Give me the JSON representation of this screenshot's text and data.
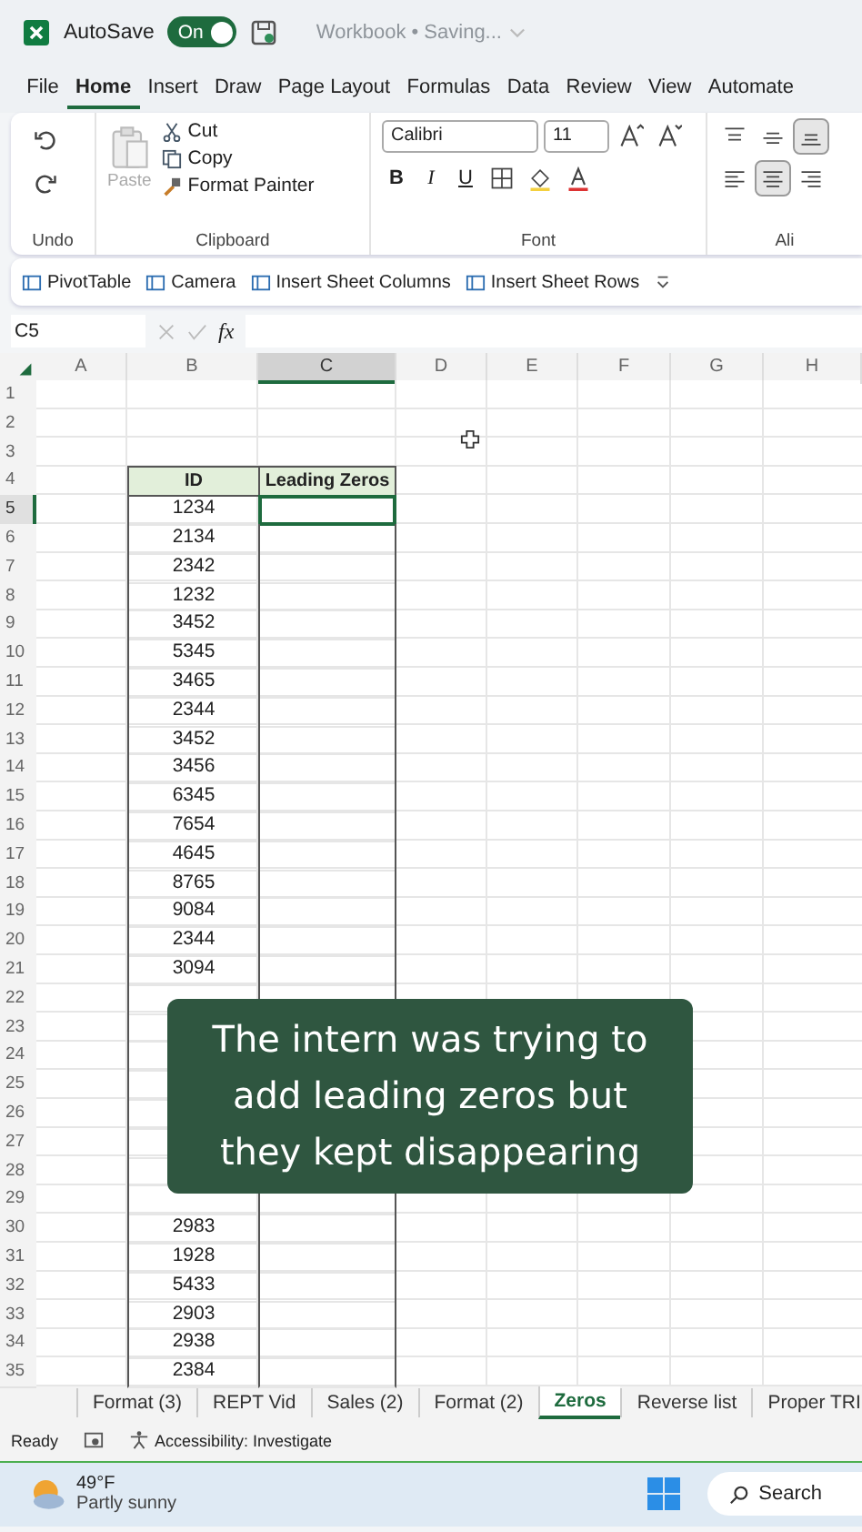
{
  "title_bar": {
    "autosave_label": "AutoSave",
    "autosave_on": true,
    "toggle_text": "On",
    "doc_title": "Workbook • Saving..."
  },
  "menu_tabs": [
    {
      "label": "File",
      "selected": false
    },
    {
      "label": "Home",
      "selected": true
    },
    {
      "label": "Insert",
      "selected": false
    },
    {
      "label": "Draw",
      "selected": false
    },
    {
      "label": "Page Layout",
      "selected": false
    },
    {
      "label": "Formulas",
      "selected": false
    },
    {
      "label": "Data",
      "selected": false
    },
    {
      "label": "Review",
      "selected": false
    },
    {
      "label": "View",
      "selected": false
    },
    {
      "label": "Automate",
      "selected": false
    }
  ],
  "ribbon": {
    "undo_label": "Undo",
    "paste": "Paste",
    "cut": "Cut",
    "copy": "Copy",
    "format_painter": "Format Painter",
    "clipboard_label": "Clipboard",
    "font_name": "Calibri",
    "font_size": "11",
    "bold": "B",
    "italic": "I",
    "underline": "U",
    "font_label": "Font",
    "alignment_label": "Ali"
  },
  "quick_bar": [
    "PivotTable",
    "Camera",
    "Insert Sheet Columns",
    "Insert Sheet Rows"
  ],
  "formula_bar": {
    "name_box": "C5",
    "fx": "fx"
  },
  "columns": [
    {
      "label": "A",
      "selected": false
    },
    {
      "label": "B",
      "selected": false
    },
    {
      "label": "C",
      "selected": true
    },
    {
      "label": "D",
      "selected": false
    },
    {
      "label": "E",
      "selected": false
    },
    {
      "label": "F",
      "selected": false
    },
    {
      "label": "G",
      "selected": false
    },
    {
      "label": "H",
      "selected": false
    }
  ],
  "rows": [
    {
      "number": "1",
      "kind": "empty",
      "selected": false
    },
    {
      "number": "2",
      "kind": "empty",
      "selected": false
    },
    {
      "number": "3",
      "kind": "empty",
      "selected": false
    },
    {
      "number": "4",
      "kind": "header",
      "selected": false,
      "b": "ID",
      "c": "Leading Zeros"
    },
    {
      "number": "5",
      "kind": "data",
      "selected": true,
      "b": "1234"
    },
    {
      "number": "6",
      "kind": "data",
      "selected": false,
      "b": "2134"
    },
    {
      "number": "7",
      "kind": "data",
      "selected": false,
      "b": "2342"
    },
    {
      "number": "8",
      "kind": "data",
      "selected": false,
      "b": "1232"
    },
    {
      "number": "9",
      "kind": "data",
      "selected": false,
      "b": "3452"
    },
    {
      "number": "10",
      "kind": "data",
      "selected": false,
      "b": "5345"
    },
    {
      "number": "11",
      "kind": "data",
      "selected": false,
      "b": "3465"
    },
    {
      "number": "12",
      "kind": "data",
      "selected": false,
      "b": "2344"
    },
    {
      "number": "13",
      "kind": "data",
      "selected": false,
      "b": "3452"
    },
    {
      "number": "14",
      "kind": "data",
      "selected": false,
      "b": "3456"
    },
    {
      "number": "15",
      "kind": "data",
      "selected": false,
      "b": "6345"
    },
    {
      "number": "16",
      "kind": "data",
      "selected": false,
      "b": "7654"
    },
    {
      "number": "17",
      "kind": "data",
      "selected": false,
      "b": "4645"
    },
    {
      "number": "18",
      "kind": "data",
      "selected": false,
      "b": "8765"
    },
    {
      "number": "19",
      "kind": "data",
      "selected": false,
      "b": "9084"
    },
    {
      "number": "20",
      "kind": "data",
      "selected": false,
      "b": "2344"
    },
    {
      "number": "21",
      "kind": "data",
      "selected": false,
      "b": "3094"
    },
    {
      "number": "22",
      "kind": "data",
      "selected": false
    },
    {
      "number": "23",
      "kind": "covered",
      "selected": false
    },
    {
      "number": "24",
      "kind": "covered",
      "selected": false
    },
    {
      "number": "25",
      "kind": "covered",
      "selected": false
    },
    {
      "number": "26",
      "kind": "covered",
      "selected": false
    },
    {
      "number": "27",
      "kind": "data",
      "selected": false
    },
    {
      "number": "28",
      "kind": "data",
      "selected": false
    },
    {
      "number": "29",
      "kind": "data",
      "selected": false
    },
    {
      "number": "30",
      "kind": "data",
      "selected": false,
      "b": "2983"
    },
    {
      "number": "31",
      "kind": "data",
      "selected": false,
      "b": "1928"
    },
    {
      "number": "32",
      "kind": "data",
      "selected": false,
      "b": "5433"
    },
    {
      "number": "33",
      "kind": "data",
      "selected": false,
      "b": "2903"
    },
    {
      "number": "34",
      "kind": "data",
      "selected": false,
      "b": "2938"
    },
    {
      "number": "35",
      "kind": "data",
      "selected": false,
      "b": "2384"
    }
  ],
  "caption": [
    "The intern was trying to",
    "add leading zeros but",
    "they kept disappearing"
  ],
  "sheet_tabs": [
    {
      "label": "Format (3)",
      "selected": false
    },
    {
      "label": "REPT Vid",
      "selected": false
    },
    {
      "label": "Sales (2)",
      "selected": false
    },
    {
      "label": "Format (2)",
      "selected": false
    },
    {
      "label": "Zeros",
      "selected": true
    },
    {
      "label": "Reverse list",
      "selected": false
    },
    {
      "label": "Proper TRI",
      "selected": false
    }
  ],
  "status_bar": {
    "ready": "Ready",
    "accessibility": "Accessibility: Investigate"
  },
  "taskbar": {
    "temperature": "49°F",
    "weather": "Partly sunny",
    "search": "Search"
  }
}
